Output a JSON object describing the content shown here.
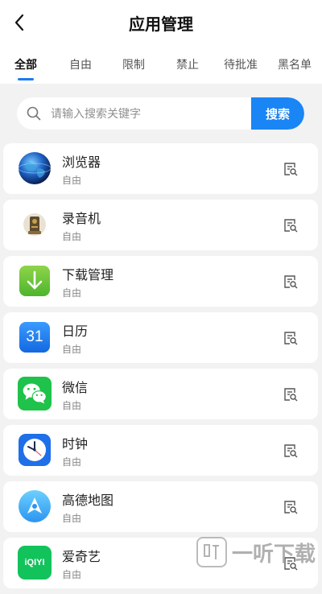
{
  "header": {
    "title": "应用管理"
  },
  "tabs": [
    {
      "label": "全部",
      "active": true
    },
    {
      "label": "自由"
    },
    {
      "label": "限制"
    },
    {
      "label": "禁止"
    },
    {
      "label": "待批准"
    },
    {
      "label": "黑名单"
    }
  ],
  "search": {
    "placeholder": "请输入搜索关键字",
    "button": "搜索"
  },
  "apps": [
    {
      "name": "浏览器",
      "status": "自由",
      "icon": "browser-globe-icon"
    },
    {
      "name": "录音机",
      "status": "自由",
      "icon": "recorder-icon"
    },
    {
      "name": "下载管理",
      "status": "自由",
      "icon": "download-arrow-icon"
    },
    {
      "name": "日历",
      "status": "自由",
      "icon": "calendar-icon",
      "icon_text": "31"
    },
    {
      "name": "微信",
      "status": "自由",
      "icon": "wechat-icon"
    },
    {
      "name": "时钟",
      "status": "自由",
      "icon": "clock-icon"
    },
    {
      "name": "高德地图",
      "status": "自由",
      "icon": "amap-icon"
    },
    {
      "name": "爱奇艺",
      "status": "自由",
      "icon": "iqiyi-icon",
      "icon_text": "iQIYI"
    }
  ],
  "watermark": {
    "text": "一听下载"
  },
  "colors": {
    "accent": "#1a85f5",
    "background": "#f2f2f2"
  }
}
